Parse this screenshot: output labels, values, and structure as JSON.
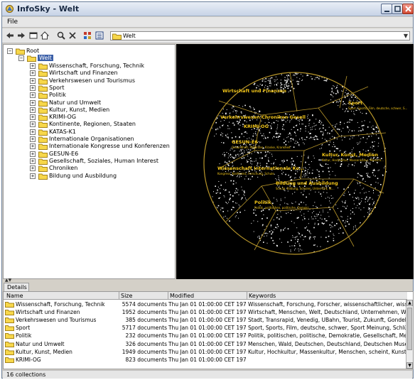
{
  "window": {
    "title": "InfoSky - Welt"
  },
  "menu": {
    "file": "File"
  },
  "toolbar": {
    "icons": [
      "back-icon",
      "forward-icon",
      "window-icon",
      "home-icon",
      "search-icon",
      "delete-icon",
      "tree-icon",
      "details-icon"
    ],
    "path_value": "Welt"
  },
  "tree": {
    "root": "Root",
    "selected": "Welt",
    "items": [
      "Wissenschaft, Forschung, Technik",
      "Wirtschaft und Finanzen",
      "Verkehrswesen und Tourismus",
      "Sport",
      "Politik",
      "Natur und Umwelt",
      "Kultur, Kunst, Medien",
      "KRIMI-OG",
      "Kontinente, Regionen, Staaten",
      "KATAS-K1",
      "Internationale Organisationen",
      "Internationale Kongresse und Konferenzen",
      "GESUN-E6",
      "Gesellschaft, Soziales, Human Interest",
      "Chroniken",
      "Bildung und Ausbildung"
    ]
  },
  "viz": {
    "labels": [
      {
        "title": "Wirtschaft und Finanzen"
      },
      {
        "title": "Sport",
        "sub": "Sport, Sports, Film, deutsche, schwer, S..."
      },
      {
        "title": "Verkehrswesen Chroniken Gesell"
      },
      {
        "title": "KRIMI-OG"
      },
      {
        "title": "GESUN-E6",
        "sub": "Gesundheit, Patienten, Kranke, Krankheit"
      },
      {
        "title": "Kultur, Kunst, Medien",
        "sub": "Kultur, Hochkultur, Massenkultur, Mensch..."
      },
      {
        "title": "Wissenschaft Internationale Ko...",
        "sub": "Kongress, Konferenz, Forschung, Schule"
      },
      {
        "title": "Bildung und Ausbildung",
        "sub": "Schule, Bildung, Schulen, Unterricht, St..."
      },
      {
        "title": "Politik",
        "sub": "Politik, politischen, politische, Demokr..."
      }
    ],
    "colors": {
      "background": "#000000",
      "boundary": "#b8962a",
      "label": "#f0c419",
      "dots": "#ffffff"
    }
  },
  "details": {
    "tab": "Details",
    "columns": [
      "Name",
      "Size",
      "Modified",
      "Keywords"
    ],
    "rows": [
      [
        "Wissenschaft, Forschung, Technik",
        "5574 documents",
        "Thu Jan 01 01:00:00 CET 1970",
        "Wissenschaft, Forschung, Forscher, wissenschaftlicher, wisse"
      ],
      [
        "Wirtschaft und Finanzen",
        "1952 documents",
        "Thu Jan 01 01:00:00 CET 1970",
        "Wirtschaft, Menschen, Welt, Deutschland, Unternehmen, Weltwi"
      ],
      [
        "Verkehrswesen und Tourismus",
        "385 documents",
        "Thu Jan 01 01:00:00 CET 1970",
        "Stadt, Transrapid, Venedig, UBahn, Tourist, Zukunft, Gondel, Ba"
      ],
      [
        "Sport",
        "5717 documents",
        "Thu Jan 01 01:00:00 CET 1970",
        "Sport, Sports, Film, deutsche, schwer, Sport Meinung, Schlündo"
      ],
      [
        "Politik",
        "232 documents",
        "Thu Jan 01 01:00:00 CET 1970",
        "Politik, politischen, politische, Demokratie, Gesellschaft, Mensche"
      ],
      [
        "Natur und Umwelt",
        "326 documents",
        "Thu Jan 01 01:00:00 CET 1970",
        "Menschen, Wald, Deutschen, Deutschland, Deutschen Museum,"
      ],
      [
        "Kultur, Kunst, Medien",
        "1949 documents",
        "Thu Jan 01 01:00:00 CET 1970",
        "Kultur, Hochkultur, Massenkultur, Menschen, scheint, Kunst, nic"
      ],
      [
        "KRIMI-OG",
        "823 documents",
        "Thu Jan 01 01:00:00 CET 1970",
        ""
      ]
    ]
  },
  "status": {
    "text": "16 collections"
  }
}
